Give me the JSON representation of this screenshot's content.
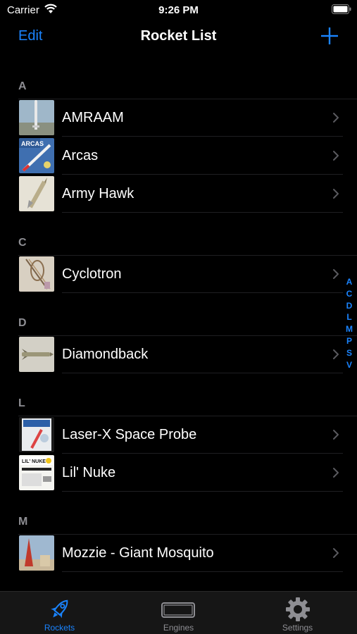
{
  "status": {
    "carrier": "Carrier",
    "time": "9:26 PM"
  },
  "nav": {
    "edit_label": "Edit",
    "title": "Rocket List",
    "add_icon": "plus-icon"
  },
  "sections": [
    {
      "letter": "A",
      "rows": [
        {
          "name": "AMRAAM",
          "thumb": "amraam"
        },
        {
          "name": "Arcas",
          "thumb": "arcas"
        },
        {
          "name": "Army Hawk",
          "thumb": "armyhawk"
        }
      ]
    },
    {
      "letter": "C",
      "rows": [
        {
          "name": "Cyclotron",
          "thumb": "cyclotron"
        }
      ]
    },
    {
      "letter": "D",
      "rows": [
        {
          "name": "Diamondback",
          "thumb": "diamondback"
        }
      ]
    },
    {
      "letter": "L",
      "rows": [
        {
          "name": "Laser-X Space Probe",
          "thumb": "laserx"
        },
        {
          "name": "Lil' Nuke",
          "thumb": "lilnuke"
        }
      ]
    },
    {
      "letter": "M",
      "rows": [
        {
          "name": "Mozzie - Giant Mosquito",
          "thumb": "mozzie"
        }
      ]
    }
  ],
  "index_letters": [
    "A",
    "C",
    "D",
    "L",
    "M",
    "P",
    "S",
    "V"
  ],
  "tabs": [
    {
      "label": "Rockets",
      "icon": "rocket-icon",
      "active": true
    },
    {
      "label": "Engines",
      "icon": "engine-icon",
      "active": false
    },
    {
      "label": "Settings",
      "icon": "gear-icon",
      "active": false
    }
  ],
  "thumb_text": {
    "arcas": "ARCAS",
    "lilnuke": "LIL' NUKE"
  },
  "colors": {
    "accent": "#1a84ff",
    "background": "#000000",
    "secondary_text": "#8e8e93"
  }
}
